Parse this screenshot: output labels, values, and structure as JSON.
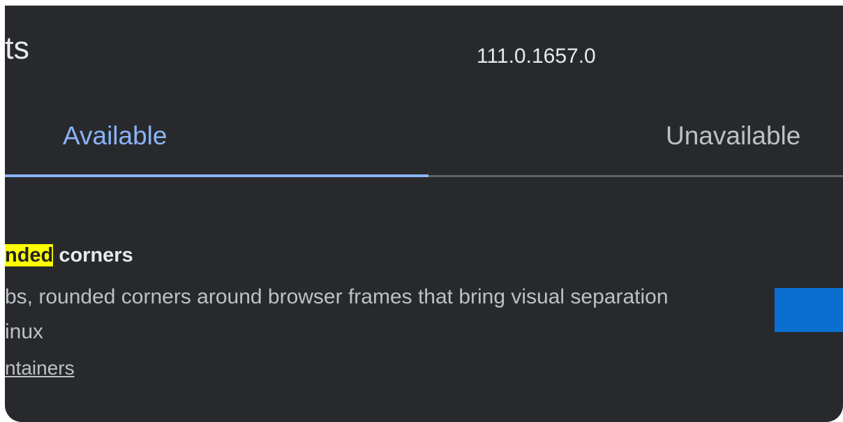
{
  "header": {
    "title": "ts",
    "version": "111.0.1657.0"
  },
  "tabs": [
    {
      "label": "Available",
      "selected": true
    },
    {
      "label": "Unavailable",
      "selected": false
    }
  ],
  "experiment": {
    "name_highlight": "nded",
    "name_rest": " corners",
    "description": "bs, rounded corners around browser frames that bring visual separation",
    "platforms": "inux",
    "link_text": "ntainers"
  },
  "colors": {
    "background": "#28292c",
    "accent": "#8ab4f8",
    "highlight": "#ffff00",
    "control": "#0b6fd1"
  }
}
